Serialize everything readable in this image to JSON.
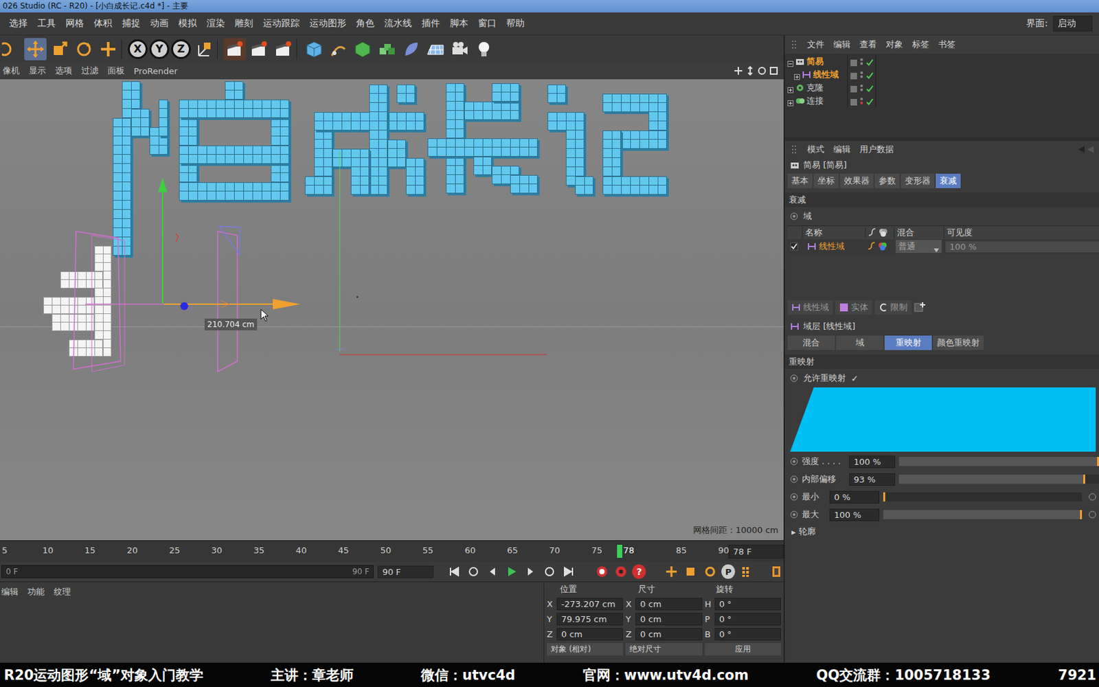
{
  "window": {
    "title": "026 Studio (RC - R20) - [小白成长记.c4d *] - 主要"
  },
  "menu": [
    "选择",
    "工具",
    "网格",
    "体积",
    "捕捉",
    "动画",
    "模拟",
    "渲染",
    "雕刻",
    "运动跟踪",
    "运动图形",
    "角色",
    "流水线",
    "插件",
    "脚本",
    "窗口",
    "帮助"
  ],
  "layout": {
    "label": "界面:",
    "value": "启动"
  },
  "toolbar": {
    "axes": [
      "X",
      "Y",
      "Z"
    ]
  },
  "viewport": {
    "menu": [
      "像机",
      "显示",
      "选项",
      "过滤",
      "面板",
      "ProRender"
    ],
    "tooltip": "210.704 cm",
    "grid_spacing": "网格间距 : 10000 cm"
  },
  "objects": {
    "menu": [
      "文件",
      "编辑",
      "查看",
      "对象",
      "标签",
      "书签"
    ],
    "tree": [
      {
        "name": "简易",
        "depth": 0,
        "kind": "effector",
        "expanded": true,
        "selected": true
      },
      {
        "name": "线性域",
        "depth": 1,
        "kind": "field",
        "expanded": false,
        "selected": true
      },
      {
        "name": "克隆",
        "depth": 0,
        "kind": "cloner",
        "expanded": false,
        "selected": false
      },
      {
        "name": "连接",
        "depth": 0,
        "kind": "connect",
        "expanded": false,
        "selected": false
      }
    ]
  },
  "attributes": {
    "menu": [
      "模式",
      "编辑",
      "用户数据"
    ],
    "object": "简易 [简易]",
    "tabs": [
      {
        "label": "基本",
        "selected": false
      },
      {
        "label": "坐标",
        "selected": false
      },
      {
        "label": "效果器",
        "selected": false
      },
      {
        "label": "参数",
        "selected": false
      },
      {
        "label": "变形器",
        "selected": false
      },
      {
        "label": "衰减",
        "selected": true
      }
    ],
    "section": "衰减",
    "field_label": "域",
    "columns": [
      "名称",
      "混合",
      "可见度"
    ],
    "fields": [
      {
        "name": "线性域",
        "blend": "普通",
        "visibility": "100 %",
        "enabled": true
      }
    ],
    "field_buttons": [
      "线性域",
      "实体",
      "限制"
    ],
    "layer": "域层 [线性域]",
    "layer_tabs": [
      {
        "label": "混合",
        "selected": false
      },
      {
        "label": "域",
        "selected": false
      },
      {
        "label": "重映射",
        "selected": true
      },
      {
        "label": "颜色重映射",
        "selected": false
      }
    ],
    "remap_section": "重映射",
    "allow_remap": {
      "label": "允许重映射",
      "mark": "✓",
      "checked": true
    },
    "params": [
      {
        "label": "强度 . . . .",
        "value": "100 %",
        "level": 1,
        "kind": "plain"
      },
      {
        "label": "内部偏移",
        "value": "93 %",
        "level": 0.93,
        "kind": "plain"
      },
      {
        "label": "最小",
        "value": "0 %",
        "level": 0,
        "kind": "ranged"
      },
      {
        "label": "最大",
        "value": "100 %",
        "level": 1,
        "kind": "ranged"
      }
    ],
    "outline_arrow": "▸",
    "outline": "轮廓"
  },
  "timeline": {
    "ticks": [
      "5",
      "10",
      "15",
      "20",
      "25",
      "30",
      "35",
      "40",
      "45",
      "50",
      "55",
      "60",
      "65",
      "70",
      "75",
      "85",
      "90"
    ],
    "playhead": "78",
    "frame_field": "78 F"
  },
  "transport": {
    "start": "0 F",
    "end": "90 F",
    "max_field": "90 F",
    "help": "?",
    "key_p": "P"
  },
  "material": {
    "menu": [
      "编辑",
      "功能",
      "纹理"
    ]
  },
  "coords": {
    "headers": [
      "位置",
      "尺寸",
      "旋转"
    ],
    "rows": [
      [
        "X",
        "-273.207 cm",
        "X",
        "0 cm",
        "H",
        "0 °"
      ],
      [
        "Y",
        "79.975 cm",
        "Y",
        "0 cm",
        "P",
        "0 °"
      ],
      [
        "Z",
        "0 cm",
        "Z",
        "0 cm",
        "B",
        "0 °"
      ]
    ],
    "modes": [
      "对象 (相对)",
      "绝对尺寸"
    ],
    "apply": "应用"
  },
  "banner": [
    "R20运动图形“域”对象入门教学",
    "主讲：章老师",
    "微信：utvc4d",
    "官网：www.utv4d.com",
    "QQ交流群：1005718133",
    "7921"
  ]
}
